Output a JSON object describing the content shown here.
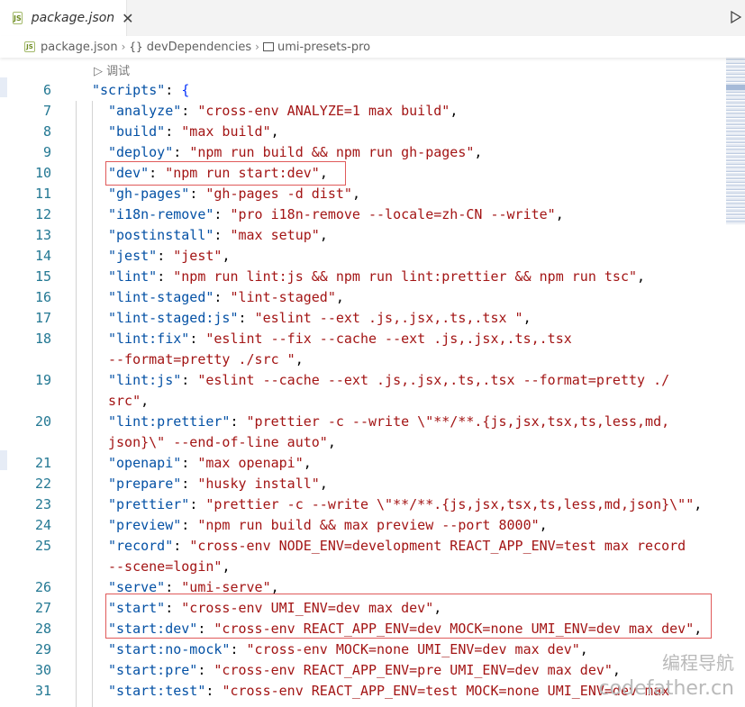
{
  "tab": {
    "label": "package.json",
    "js_badge": "JS",
    "close": "✕"
  },
  "breadcrumb": {
    "file": "package.json",
    "item1": "devDependencies",
    "item2": "umi-presets-pro",
    "braces": "{}"
  },
  "editor": {
    "codelens": "▷ 调试",
    "lines": [
      {
        "n": "6",
        "key": "\"scripts\"",
        "sep": ": ",
        "val": "{",
        "indent": 0
      },
      {
        "n": "7",
        "key": "\"analyze\"",
        "sep": ": ",
        "val": "\"cross-env ANALYZE=1 max build\"",
        "end": ",",
        "indent": 1
      },
      {
        "n": "8",
        "key": "\"build\"",
        "sep": ": ",
        "val": "\"max build\"",
        "end": ",",
        "indent": 1
      },
      {
        "n": "9",
        "key": "\"deploy\"",
        "sep": ": ",
        "val": "\"npm run build && npm run gh-pages\"",
        "end": ",",
        "indent": 1
      },
      {
        "n": "10",
        "key": "\"dev\"",
        "sep": ": ",
        "val": "\"npm run start:dev\"",
        "end": ",",
        "indent": 1
      },
      {
        "n": "11",
        "key": "\"gh-pages\"",
        "sep": ": ",
        "val": "\"gh-pages -d dist\"",
        "end": ",",
        "indent": 1
      },
      {
        "n": "12",
        "key": "\"i18n-remove\"",
        "sep": ": ",
        "val": "\"pro i18n-remove --locale=zh-CN --write\"",
        "end": ",",
        "indent": 1
      },
      {
        "n": "13",
        "key": "\"postinstall\"",
        "sep": ": ",
        "val": "\"max setup\"",
        "end": ",",
        "indent": 1
      },
      {
        "n": "14",
        "key": "\"jest\"",
        "sep": ": ",
        "val": "\"jest\"",
        "end": ",",
        "indent": 1
      },
      {
        "n": "15",
        "key": "\"lint\"",
        "sep": ": ",
        "val": "\"npm run lint:js && npm run lint:prettier && npm run tsc\"",
        "end": ",",
        "indent": 1
      },
      {
        "n": "16",
        "key": "\"lint-staged\"",
        "sep": ": ",
        "val": "\"lint-staged\"",
        "end": ",",
        "indent": 1
      },
      {
        "n": "17",
        "key": "\"lint-staged:js\"",
        "sep": ": ",
        "val": "\"eslint --ext .js,.jsx,.ts,.tsx \"",
        "end": ",",
        "indent": 1
      },
      {
        "n": "18",
        "key": "\"lint:fix\"",
        "sep": ": ",
        "val": "\"eslint --fix --cache --ext .js,.jsx,.ts,.tsx",
        "end": "",
        "indent": 1
      },
      {
        "n": "",
        "key": "",
        "sep": "",
        "val": "--format=pretty ./src \"",
        "end": ",",
        "indent": 1
      },
      {
        "n": "19",
        "key": "\"lint:js\"",
        "sep": ": ",
        "val": "\"eslint --cache --ext .js,.jsx,.ts,.tsx --format=pretty ./",
        "end": "",
        "indent": 1
      },
      {
        "n": "",
        "key": "",
        "sep": "",
        "val": "src\"",
        "end": ",",
        "indent": 1
      },
      {
        "n": "20",
        "key": "\"lint:prettier\"",
        "sep": ": ",
        "val": "\"prettier -c --write \\\"**/**.{js,jsx,tsx,ts,less,md,",
        "end": "",
        "indent": 1
      },
      {
        "n": "",
        "key": "",
        "sep": "",
        "val": "json}\\\" --end-of-line auto\"",
        "end": ",",
        "indent": 1
      },
      {
        "n": "21",
        "key": "\"openapi\"",
        "sep": ": ",
        "val": "\"max openapi\"",
        "end": ",",
        "indent": 1
      },
      {
        "n": "22",
        "key": "\"prepare\"",
        "sep": ": ",
        "val": "\"husky install\"",
        "end": ",",
        "indent": 1
      },
      {
        "n": "23",
        "key": "\"prettier\"",
        "sep": ": ",
        "val": "\"prettier -c --write \\\"**/**.{js,jsx,tsx,ts,less,md,json}\\\"\"",
        "end": ",",
        "indent": 1
      },
      {
        "n": "24",
        "key": "\"preview\"",
        "sep": ": ",
        "val": "\"npm run build && max preview --port 8000\"",
        "end": ",",
        "indent": 1
      },
      {
        "n": "25",
        "key": "\"record\"",
        "sep": ": ",
        "val": "\"cross-env NODE_ENV=development REACT_APP_ENV=test max record",
        "end": "",
        "indent": 1
      },
      {
        "n": "",
        "key": "",
        "sep": "",
        "val": "--scene=login\"",
        "end": ",",
        "indent": 1
      },
      {
        "n": "26",
        "key": "\"serve\"",
        "sep": ": ",
        "val": "\"umi-serve\"",
        "end": ",",
        "indent": 1
      },
      {
        "n": "27",
        "key": "\"start\"",
        "sep": ": ",
        "val": "\"cross-env UMI_ENV=dev max dev\"",
        "end": ",",
        "indent": 1
      },
      {
        "n": "28",
        "key": "\"start:dev\"",
        "sep": ": ",
        "val": "\"cross-env REACT_APP_ENV=dev MOCK=none UMI_ENV=dev max dev\"",
        "end": ",",
        "indent": 1
      },
      {
        "n": "29",
        "key": "\"start:no-mock\"",
        "sep": ": ",
        "val": "\"cross-env MOCK=none UMI_ENV=dev max dev\"",
        "end": ",",
        "indent": 1
      },
      {
        "n": "30",
        "key": "\"start:pre\"",
        "sep": ": ",
        "val": "\"cross-env REACT_APP_ENV=pre UMI_ENV=dev max dev\"",
        "end": ",",
        "indent": 1
      },
      {
        "n": "31",
        "key": "\"start:test\"",
        "sep": ": ",
        "val": "\"cross-env REACT_APP_ENV=test MOCK=none UMI_ENV=dev max",
        "end": "",
        "indent": 1
      }
    ]
  },
  "watermark": {
    "line1": "编程导航",
    "line2": "codefather.cn"
  },
  "colors": {
    "key": "#0451a5",
    "string": "#a31515",
    "line_number": "#237893",
    "highlight": "#e05a5a"
  }
}
